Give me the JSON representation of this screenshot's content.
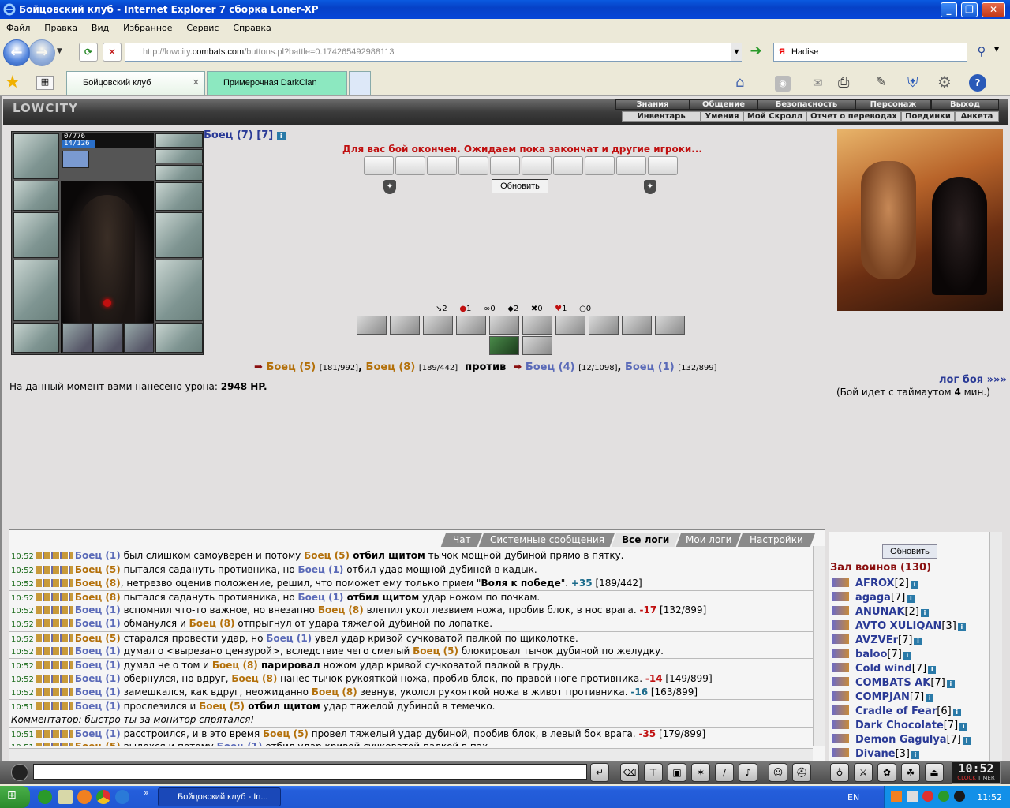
{
  "window": {
    "title": "Бойцовский клуб - Internet Explorer 7 сборка Loner-XP"
  },
  "menu": [
    "Файл",
    "Правка",
    "Вид",
    "Избранное",
    "Сервис",
    "Справка"
  ],
  "address": {
    "url_prefix": "http://lowcity.",
    "url_domain": "combats.com",
    "url_rest": "/buttons.pl?battle=0.174265492988113",
    "search_value": "Hadise"
  },
  "tabs": [
    "Бойцовский клуб",
    "Примерочная DarkClan"
  ],
  "game": {
    "logo": "LOWCITY",
    "nav_top": [
      "Знания",
      "Общение",
      "Безопасность",
      "Персонаж",
      "Выход"
    ],
    "nav_bottom": [
      "Инвентарь",
      "Умения",
      "Мой Скролл",
      "Отчет о переводах",
      "Поединки",
      "Анкета"
    ],
    "hp": "0/776",
    "mp": "14/126",
    "fighter_title": "Боец (7) [7]",
    "status_message": "Для вас бой окончен. Ожидаем пока закончат и другие игроки...",
    "refresh_label": "Обновить",
    "stats": [
      {
        "icon": "↘",
        "value": "2"
      },
      {
        "icon": "●",
        "value": "1"
      },
      {
        "icon": "∞",
        "value": "0"
      },
      {
        "icon": "◆",
        "value": "2"
      },
      {
        "icon": "✖",
        "value": "0"
      },
      {
        "icon": "♥",
        "value": "1"
      },
      {
        "icon": "○",
        "value": "0"
      }
    ],
    "team1": [
      {
        "name": "Боец (5)",
        "hp": "[181/992]"
      },
      {
        "name": "Боец (8)",
        "hp": "[189/442]"
      }
    ],
    "vs_label": "против",
    "team2": [
      {
        "name": "Боец (4)",
        "hp": "[12/1098]"
      },
      {
        "name": "Боец (1)",
        "hp": "[132/899]"
      }
    ],
    "log_link": "лог боя »»»",
    "timeout_text_1": "(Бой идет с таймаутом",
    "timeout_value": "4",
    "timeout_text_2": "мин.)",
    "damage_text": "На данный момент вами нанесено урона:",
    "damage_value": "2948 HP."
  },
  "chat": {
    "tabs": [
      "Чат",
      "Системные сообщения",
      "Все логи",
      "Мои логи",
      "Настройки"
    ],
    "active_tab": "Все логи",
    "lines": [
      {
        "time": "10:52",
        "parts": [
          [
            "n1",
            "Боец (1)"
          ],
          [
            "t",
            " был слишком самоуверен и потому "
          ],
          [
            "n2",
            "Боец (5)"
          ],
          [
            "b",
            " отбил щитом"
          ],
          [
            "t",
            " тычок мощной дубиной прямо в пятку."
          ]
        ]
      },
      {
        "time": "10:52",
        "parts": [
          [
            "n2",
            "Боец (5)"
          ],
          [
            "t",
            " пытался садануть противника, но "
          ],
          [
            "n1",
            "Боец (1)"
          ],
          [
            "t",
            " отбил удар мощной дубиной в кадык."
          ]
        ]
      },
      {
        "time": "10:52",
        "parts": [
          [
            "n2",
            "Боец (8)"
          ],
          [
            "t",
            ", нетрезво оценив положение, решил, что поможет ему только прием \""
          ],
          [
            "b",
            "Воля к победе"
          ],
          [
            "t",
            "\". "
          ],
          [
            "g",
            "+35"
          ],
          [
            "t",
            " [189/442]"
          ]
        ]
      },
      {
        "time": "10:52",
        "parts": [
          [
            "n2",
            "Боец (8)"
          ],
          [
            "t",
            " пытался садануть противника, но "
          ],
          [
            "n1",
            "Боец (1)"
          ],
          [
            "b",
            " отбил щитом"
          ],
          [
            "t",
            " удар ножом по почкам."
          ]
        ]
      },
      {
        "time": "10:52",
        "parts": [
          [
            "n1",
            "Боец (1)"
          ],
          [
            "t",
            " вспомнил что-то важное, но внезапно "
          ],
          [
            "n2",
            "Боец (8)"
          ],
          [
            "t",
            " влепил укол лезвием ножа, пробив блок, в нос врага. "
          ],
          [
            "r",
            "-17"
          ],
          [
            "t",
            " [132/899]"
          ]
        ]
      },
      {
        "time": "10:52",
        "parts": [
          [
            "n1",
            "Боец (1)"
          ],
          [
            "t",
            " обманулся и "
          ],
          [
            "n2",
            "Боец (8)"
          ],
          [
            "t",
            " отпрыгнул от удара тяжелой дубиной по лопатке."
          ]
        ]
      },
      {
        "time": "10:52",
        "parts": [
          [
            "n2",
            "Боец (5)"
          ],
          [
            "t",
            " старался провести удар, но "
          ],
          [
            "n1",
            "Боец (1)"
          ],
          [
            "t",
            " увел удар кривой сучковатой палкой по щиколотке."
          ]
        ]
      },
      {
        "time": "10:52",
        "parts": [
          [
            "n1",
            "Боец (1)"
          ],
          [
            "t",
            " думал о <вырезано цензурой>, вследствие чего смелый "
          ],
          [
            "n2",
            "Боец (5)"
          ],
          [
            "t",
            " блокировал тычок дубиной по желудку."
          ]
        ]
      },
      {
        "time": "10:52",
        "parts": [
          [
            "n1",
            "Боец (1)"
          ],
          [
            "t",
            " думал не о том и "
          ],
          [
            "n2",
            "Боец (8)"
          ],
          [
            "b",
            " парировал"
          ],
          [
            "t",
            " ножом удар кривой сучковатой палкой в грудь."
          ]
        ]
      },
      {
        "time": "10:52",
        "parts": [
          [
            "n1",
            "Боец (1)"
          ],
          [
            "t",
            " обернулся, но вдруг, "
          ],
          [
            "n2",
            "Боец (8)"
          ],
          [
            "t",
            " нанес тычок рукояткой ножа, пробив блок, по правой ноге противника. "
          ],
          [
            "r",
            "-14"
          ],
          [
            "t",
            " [149/899]"
          ]
        ]
      },
      {
        "time": "10:52",
        "parts": [
          [
            "n1",
            "Боец (1)"
          ],
          [
            "t",
            " замешкался, как вдруг, неожиданно "
          ],
          [
            "n2",
            "Боец (8)"
          ],
          [
            "t",
            " зевнув, уколол рукояткой ножа в живот противника. "
          ],
          [
            "g",
            "-16"
          ],
          [
            "t",
            " [163/899]"
          ]
        ]
      },
      {
        "time": "10:51",
        "parts": [
          [
            "n1",
            "Боец (1)"
          ],
          [
            "t",
            " прослезился и "
          ],
          [
            "n2",
            "Боец (5)"
          ],
          [
            "b",
            " отбил щитом"
          ],
          [
            "t",
            " удар тяжелой дубиной в темечко."
          ]
        ]
      },
      {
        "time": "",
        "parts": [
          [
            "i",
            "Комментатор: быстро ты за монитор спрятался!"
          ]
        ]
      },
      {
        "time": "10:51",
        "parts": [
          [
            "n1",
            "Боец (1)"
          ],
          [
            "t",
            " расстроился, и в это время "
          ],
          [
            "n2",
            "Боец (5)"
          ],
          [
            "t",
            " провел тяжелый удар дубиной, пробив блок, в левый бок врага. "
          ],
          [
            "r",
            "-35"
          ],
          [
            "t",
            " [179/899]"
          ]
        ]
      },
      {
        "time": "10:51",
        "parts": [
          [
            "n2",
            "Боец (5)"
          ],
          [
            "t",
            " выдохся и потому "
          ],
          [
            "n1",
            "Боец (1)"
          ],
          [
            "t",
            " отбил удар кривой сучковатой палкой в пах."
          ]
        ]
      }
    ]
  },
  "online": {
    "refresh_label": "Обновить",
    "hall_title": "Зал воинов (130)",
    "players": [
      {
        "name": "AFROX",
        "level": "[2]"
      },
      {
        "name": "agaga",
        "level": "[7]"
      },
      {
        "name": "ANUNAK",
        "level": "[2]"
      },
      {
        "name": "AVTO XULIQAN",
        "level": "[3]"
      },
      {
        "name": "AVZVEr",
        "level": "[7]"
      },
      {
        "name": "baloo",
        "level": "[7]"
      },
      {
        "name": "Cold wind",
        "level": "[7]"
      },
      {
        "name": "COMBATS AK",
        "level": "[7]"
      },
      {
        "name": "COMPJAN",
        "level": "[7]"
      },
      {
        "name": "Cradle of Fear",
        "level": "[6]"
      },
      {
        "name": "Dark Chocolate",
        "level": "[7]"
      },
      {
        "name": "Demon Gagulya",
        "level": "[7]"
      },
      {
        "name": "Divane",
        "level": "[3]"
      }
    ]
  },
  "bottom": {
    "clock": "10:52",
    "clock_label": "CLOCK",
    "timer_label": "TIMER"
  },
  "taskbar": {
    "task_label": "Бойцовский клуб - In...",
    "lang": "EN",
    "time": "11:52"
  }
}
